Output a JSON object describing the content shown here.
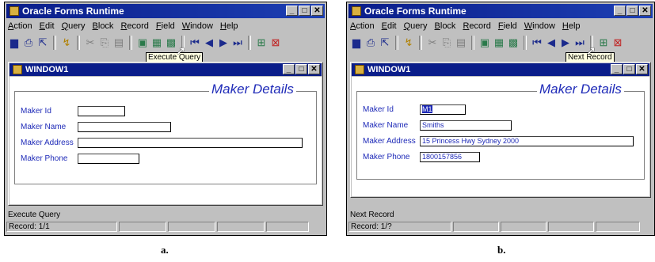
{
  "app_title": "Oracle Forms Runtime",
  "menu": [
    "Action",
    "Edit",
    "Query",
    "Block",
    "Record",
    "Field",
    "Window",
    "Help"
  ],
  "window_title": "WINDOW1",
  "group_title": "Maker Details",
  "labels": {
    "id": "Maker Id",
    "name": "Maker Name",
    "address": "Maker Address",
    "phone": "Maker Phone"
  },
  "panel_a": {
    "caption": "a.",
    "tooltip": "Execute Query",
    "status_message": "Execute Query",
    "record_status": "Record: 1/1",
    "values": {
      "id": "",
      "name": "",
      "address": "",
      "phone": ""
    }
  },
  "panel_b": {
    "caption": "b.",
    "tooltip": "Next Record",
    "status_message": "Next Record",
    "record_status": "Record: 1/?",
    "values": {
      "id": "M1",
      "name": "Smiths",
      "address": "15 Princess Hwy Sydney 2000",
      "phone": "1800157856"
    }
  },
  "window_buttons": {
    "minimize": "_",
    "maximize": "□",
    "close": "✕"
  },
  "toolbar_icons": [
    "save-icon",
    "print-icon",
    "exit-icon",
    "help-icon",
    "cut-icon",
    "copy-icon",
    "paste-icon",
    "enter-query-icon",
    "execute-query-icon",
    "cancel-query-icon",
    "first-record-icon",
    "previous-record-icon",
    "next-record-icon",
    "last-record-icon",
    "insert-record-icon",
    "delete-record-icon"
  ],
  "colors": {
    "title_bar": "#0a1d8a",
    "label_text": "#1f2bb8",
    "tooltip_bg": "#ffffe1"
  }
}
